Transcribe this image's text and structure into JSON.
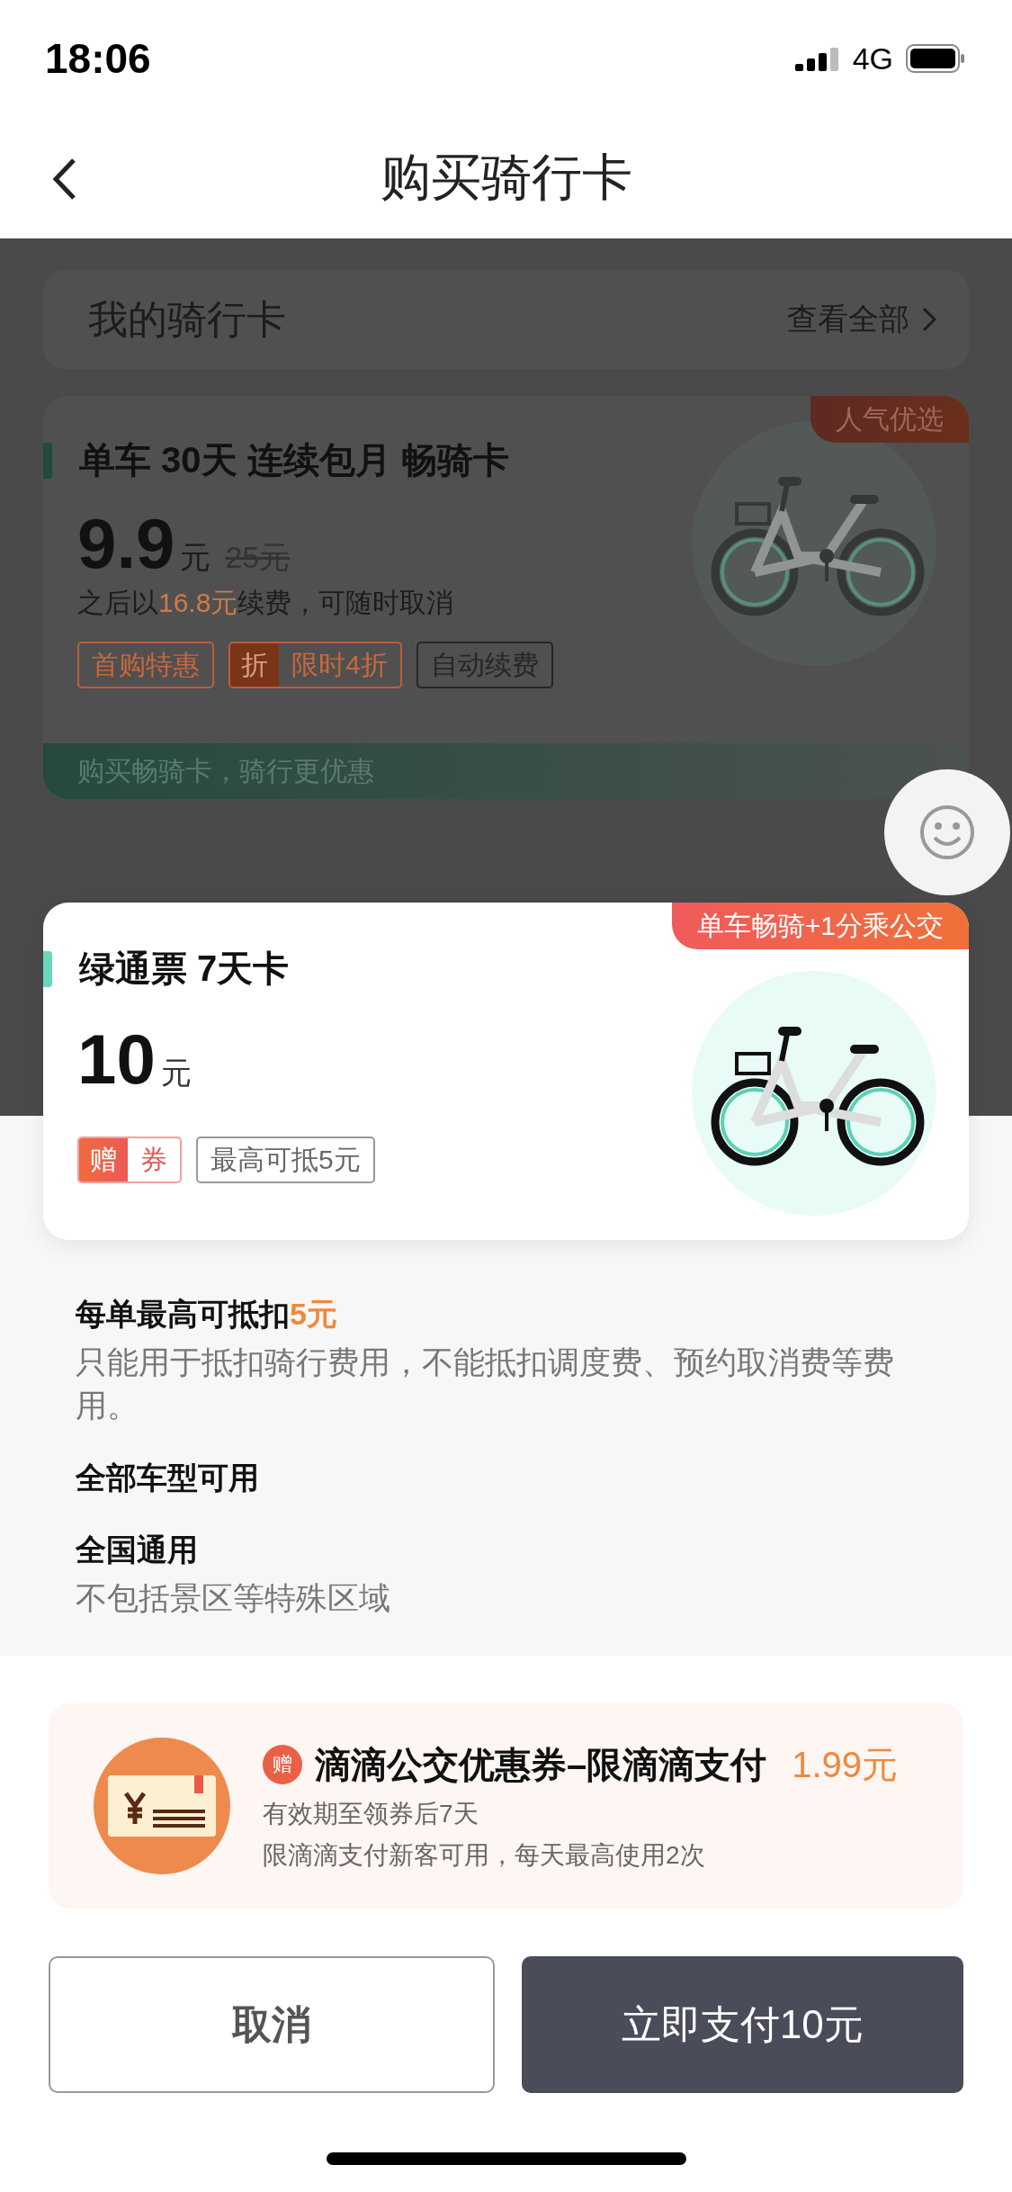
{
  "status_bar": {
    "time": "18:06",
    "network": "4G"
  },
  "nav": {
    "title": "购买骑行卡"
  },
  "my_cards": {
    "title": "我的骑行卡",
    "link": "查看全部"
  },
  "featured_card": {
    "ribbon": "人气优选",
    "title": "单车 30天 连续包月 畅骑卡",
    "price": "9.9",
    "unit": "元",
    "original_price": "25元",
    "renewal_prefix": "之后以",
    "renewal_amount": "16.8元",
    "renewal_suffix": "续费，可随时取消",
    "tags": [
      {
        "kind": "outline",
        "text": "首购特惠"
      },
      {
        "kind": "badge",
        "badge": "折",
        "text": "限时4折"
      },
      {
        "kind": "plain",
        "text": "自动续费"
      }
    ],
    "banner": "购买畅骑卡，骑行更优惠"
  },
  "selected_card": {
    "ribbon": "单车畅骑+1分乘公交",
    "title": "绿通票 7天卡",
    "price": "10",
    "unit": "元",
    "tags": [
      {
        "kind": "gift",
        "badge": "赠",
        "text": "券"
      },
      {
        "kind": "plain",
        "text": "最高可抵5元"
      }
    ]
  },
  "details": [
    {
      "title": "每单最高可抵扣",
      "highlight": "5元",
      "description": "只能用于抵扣骑行费用，不能抵扣调度费、预约取消费等费用。"
    },
    {
      "title": "全部车型可用"
    },
    {
      "title": "全国通用",
      "description": "不包括景区等特殊区域"
    }
  ],
  "coupon": {
    "badge": "赠",
    "title": "滴滴公交优惠券–限滴滴支付",
    "price": "1.99元",
    "lines": [
      "有效期至领券后7天",
      "限滴滴支付新客可用，每天最高使用2次"
    ]
  },
  "buttons": [
    {
      "kind": "secondary",
      "label": "取消"
    },
    {
      "kind": "primary",
      "label": "立即支付10元"
    }
  ]
}
